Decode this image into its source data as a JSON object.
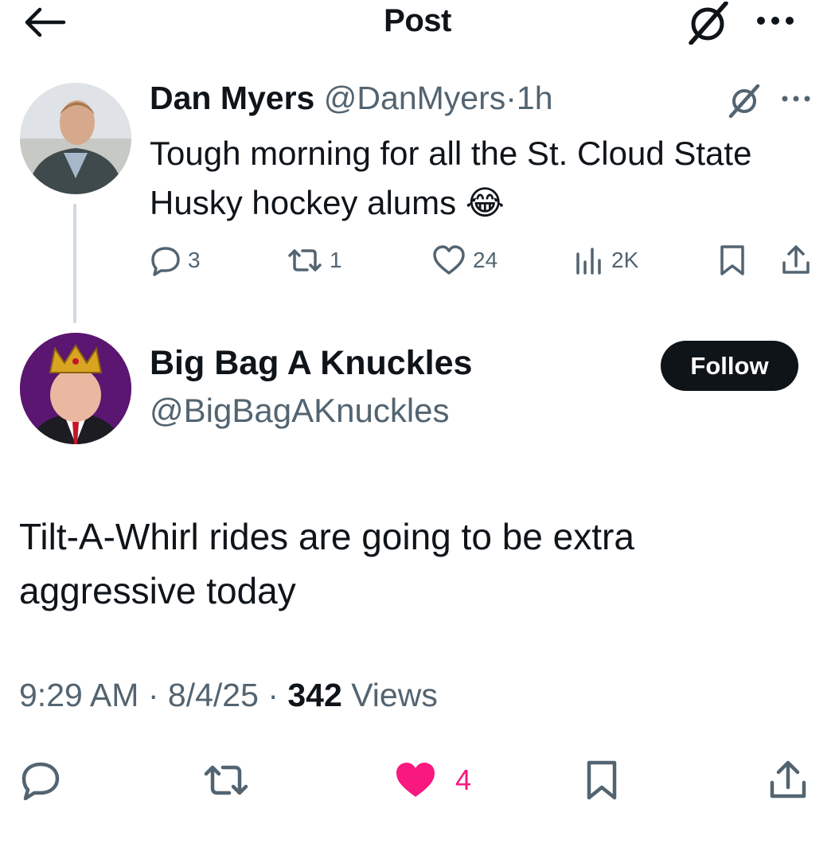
{
  "header": {
    "title": "Post",
    "back_icon": "arrow-left-icon",
    "grok_icon": "grok-icon",
    "more_icon": "more-horizontal-icon"
  },
  "parent_post": {
    "author_name": "Dan Myers",
    "author_handle": "@DanMyers",
    "separator": "·",
    "time": "1h",
    "text": "Tough morning for all the St. Cloud State Husky hockey alums 😂",
    "replies": "3",
    "reposts": "1",
    "likes": "24",
    "views": "2K"
  },
  "main_post": {
    "author_name": "Big Bag A Knuckles",
    "author_handle": "@BigBagAKnuckles",
    "follow_label": "Follow",
    "text": "Tilt-A-Whirl rides are going to be extra aggressive today",
    "time": "9:29 AM",
    "date": "8/4/25",
    "separator": "·",
    "views_count": "342",
    "views_label": "Views",
    "likes": "4"
  },
  "colors": {
    "text": "#0f1419",
    "muted": "#536471",
    "like_pink": "#f91880",
    "thread_line": "#cfd9de"
  }
}
